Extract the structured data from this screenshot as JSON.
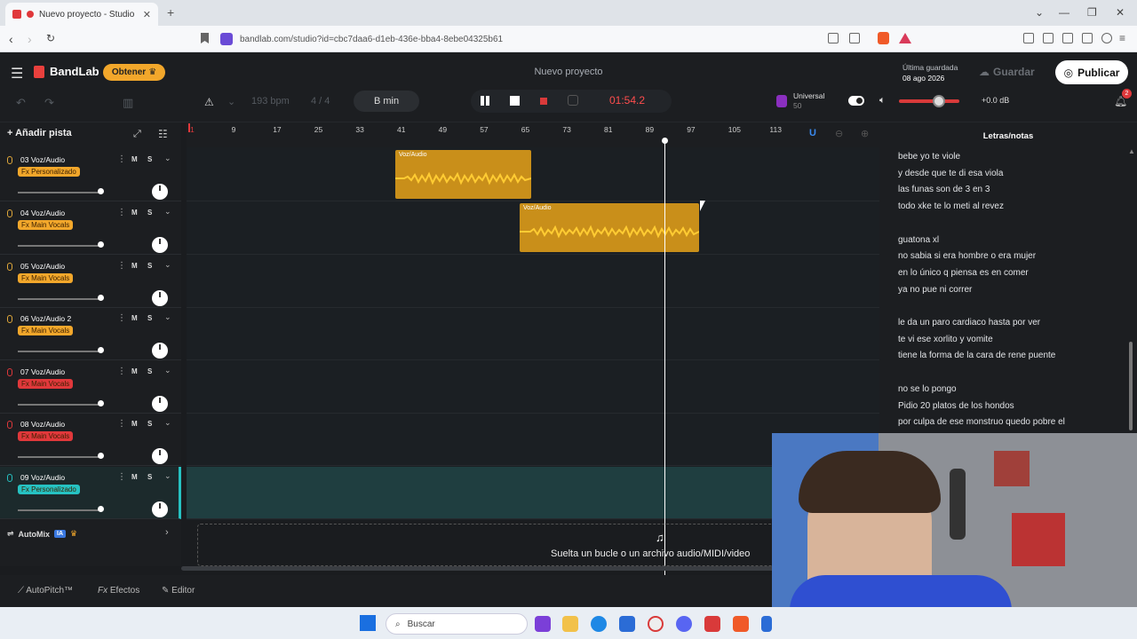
{
  "browser": {
    "tab_title": "Nuevo proyecto - Studio",
    "url": "bandlab.com/studio?id=cbc7daa6-d1eb-436e-bba4-8ebe04325b61"
  },
  "header": {
    "brand": "BandLab",
    "obtener_label": "Obtener",
    "project_title": "Nuevo proyecto",
    "last_saved_label": "Última guardada",
    "last_saved_date": "08 ago 2026",
    "save_label": "Guardar",
    "publish_label": "Publicar"
  },
  "toolbar": {
    "bpm": "193 bpm",
    "time_sig": "4 / 4",
    "key": "B min",
    "time": "01:54.2",
    "mix_preset": "Universal",
    "mix_sub": "50",
    "volume_db": "+0.0 dB",
    "notifications": "2"
  },
  "tracks_panel": {
    "add_track_label": "Añadir pista",
    "automix_label": "AutoMix",
    "ia_label": "IA",
    "tracks": [
      {
        "name": "03  Voz/Audio",
        "fx": "Fx Personalizado",
        "fx_color": "#f2a72b",
        "mic_color": "#e0a83a"
      },
      {
        "name": "04  Voz/Audio",
        "fx": "Fx Main Vocals",
        "fx_color": "#f2a72b",
        "mic_color": "#e0a83a"
      },
      {
        "name": "05  Voz/Audio",
        "fx": "Fx Main Vocals",
        "fx_color": "#f2a72b",
        "mic_color": "#e0a83a"
      },
      {
        "name": "06  Voz/Audio 2",
        "fx": "Fx Main Vocals",
        "fx_color": "#f2a72b",
        "mic_color": "#e0a83a"
      },
      {
        "name": "07  Voz/Audio",
        "fx": "Fx Main Vocals",
        "fx_color": "#e0383b",
        "mic_color": "#e0383b"
      },
      {
        "name": "08  Voz/Audio",
        "fx": "Fx Main Vocals",
        "fx_color": "#e0383b",
        "mic_color": "#e0383b"
      },
      {
        "name": "09  Voz/Audio",
        "fx": "Fx Personalizado",
        "fx_color": "#26c2c2",
        "mic_color": "#26c2c2"
      }
    ],
    "mute_label": "M",
    "solo_label": "S"
  },
  "timeline": {
    "ruler": [
      "1",
      "9",
      "17",
      "25",
      "33",
      "41",
      "49",
      "57",
      "65",
      "73",
      "81",
      "89",
      "97",
      "105",
      "113"
    ],
    "clip_label": "Voz/Audio",
    "drop_text": "Suelta un bucle o un archivo audio/MIDI/video"
  },
  "bottom": {
    "autopitch": "AutoPitch™",
    "efectos": "Efectos",
    "editor": "Editor"
  },
  "lyrics": {
    "title": "Letras/notas",
    "lines": [
      "bebe yo te viole",
      "y desde que te di esa viola",
      "las funas son de 3 en 3",
      "todo xke te lo meti al revez",
      "",
      "guatona xl",
      "no sabia si era hombre o era mujer",
      "en lo único q piensa es en comer",
      "ya no pue ni correr",
      "",
      "le da un paro cardiaco hasta por ver",
      "te vi ese xorlito y vomite",
      "tiene la forma de la cara de rene puente",
      "",
      "no se lo pongo",
      "Pidio 20 platos de los hondos",
      "por culpa de ese monstruo quedo pobre el"
    ]
  },
  "taskbar": {
    "search_placeholder": "Buscar"
  }
}
